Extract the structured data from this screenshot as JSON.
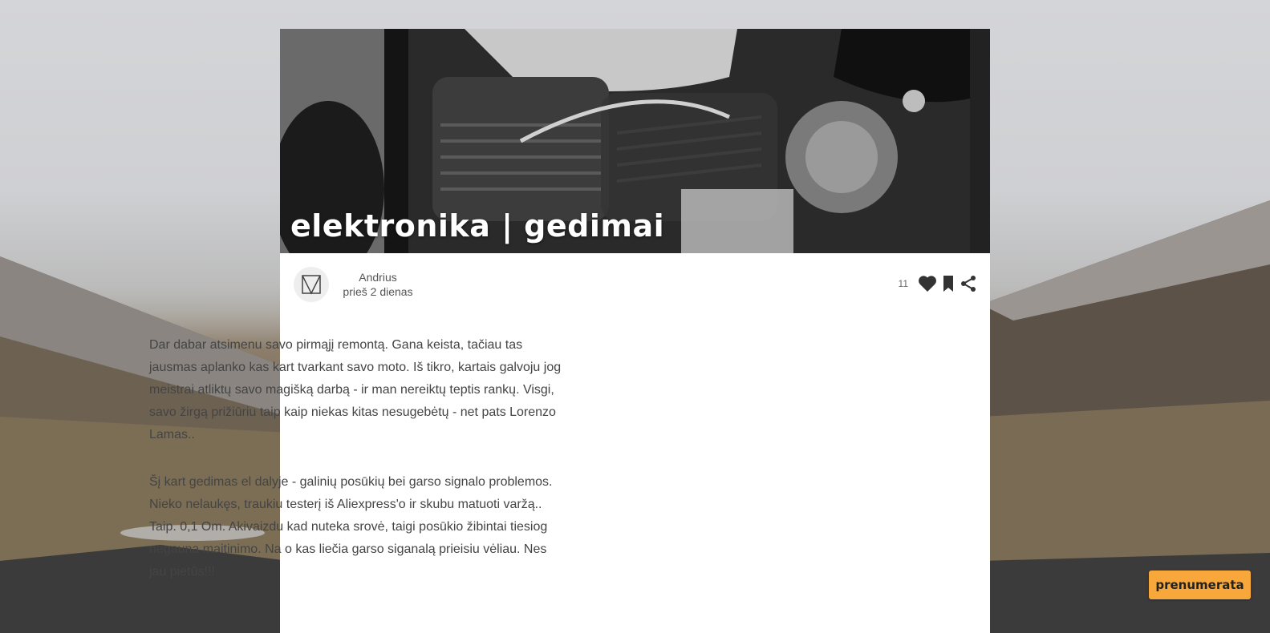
{
  "post": {
    "title": "elektronika | gedimai",
    "author_name": "Andrius",
    "posted_time": "prieš 2 dienas",
    "like_count": "11",
    "paragraphs": [
      "Dar dabar atsimenu savo pirmąjį remontą. Gana keista, tačiau tas jausmas aplanko kas kart tvarkant savo moto. Iš tikro, kartais galvoju jog meistrai atliktų savo magišką darbą - ir man nereiktų teptis rankų. Visgi, savo žirgą prižiūriu taip kaip niekas kitas nesugebėtų - net pats Lorenzo Lamas..",
      "Šį kart gedimas el dalyje - galinių posūkių bei garso signalo problemos. Nieko nelaukęs, traukiu testerį iš Aliexpress'o ir skubu matuoti varžą.. Taip. 0,1 Om. Akivaizdu kad nuteka srovė, taigi posūkio žibintai tiesiog negauna maitinimo. Na o kas liečia garso siganalą prieisiu vėliau. Nes jau pietūs!!!"
    ]
  },
  "subscribe_label": "prenumerata",
  "icons": {
    "avatar": "logo-icon",
    "like": "heart-icon",
    "bookmark": "bookmark-icon",
    "share": "share-icon"
  },
  "colors": {
    "accent": "#f8a73b",
    "text": "#444444"
  }
}
